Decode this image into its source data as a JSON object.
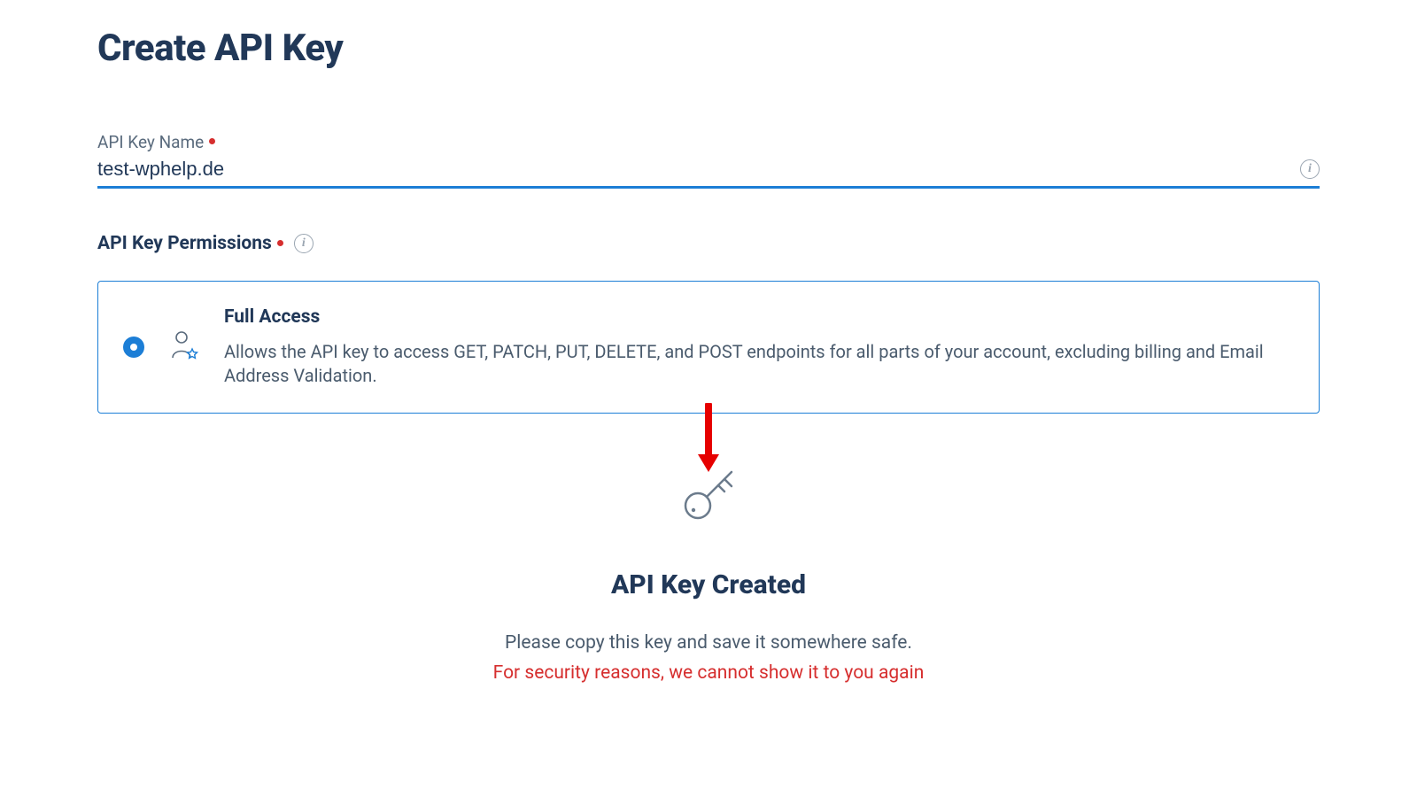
{
  "page": {
    "title": "Create API Key"
  },
  "name_field": {
    "label": "API Key Name",
    "value": "test-wphelp.de"
  },
  "permissions": {
    "label": "API Key Permissions",
    "option": {
      "title": "Full Access",
      "description": "Allows the API key to access GET, PATCH, PUT, DELETE, and POST endpoints for all parts of your account, excluding billing and Email Address Validation."
    }
  },
  "created": {
    "title": "API Key Created",
    "subtitle": "Please copy this key and save it somewhere safe.",
    "warning": "For security reasons, we cannot show it to you again"
  },
  "colors": {
    "accent": "#1c7ed6",
    "heading": "#213858",
    "danger": "#d62e2e"
  }
}
